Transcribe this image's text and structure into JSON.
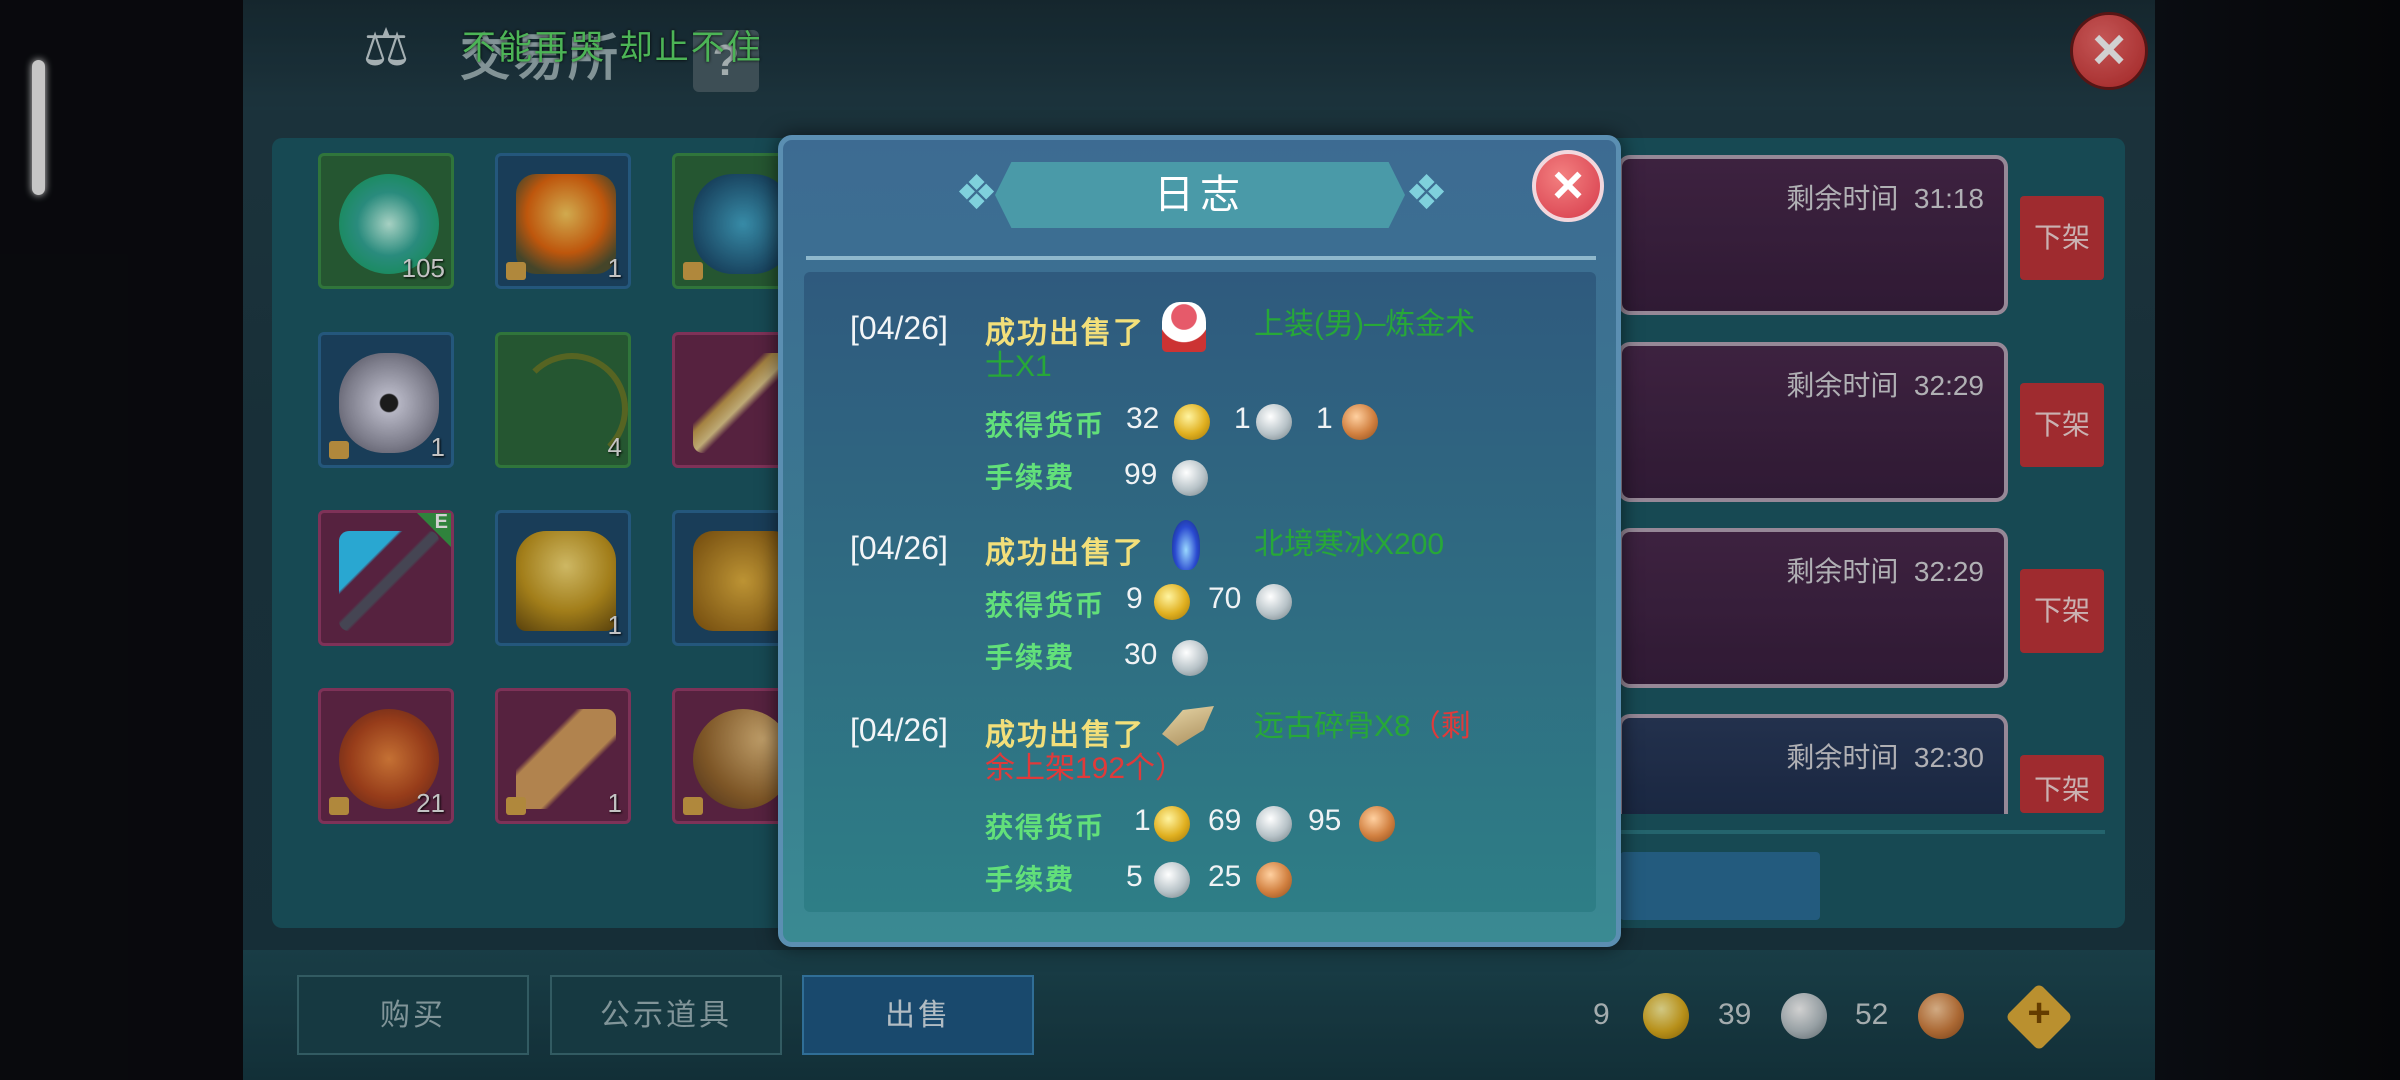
{
  "background": {
    "title": "交易所",
    "help_label": "?",
    "scroll_text": "不能再哭 却止不住",
    "close_symbol": "×",
    "grid": [
      {
        "count": "105",
        "style": "green",
        "icon": "orb-icon"
      },
      {
        "count": "1",
        "style": "blue",
        "icon": "campfire-icon"
      },
      {
        "count": "",
        "style": "green",
        "icon": "beetle-icon"
      },
      {
        "count": "1",
        "style": "blue",
        "icon": "stone-icon"
      },
      {
        "count": "4",
        "style": "green",
        "icon": "bow-icon"
      },
      {
        "count": "",
        "style": "pink",
        "icon": "dagger-icon"
      },
      {
        "count": "",
        "style": "pink",
        "icon": "staff-icon",
        "badge": "E"
      },
      {
        "count": "1",
        "style": "blue",
        "icon": "helmet-icon"
      },
      {
        "count": "",
        "style": "blue",
        "icon": "armor-icon"
      },
      {
        "count": "21",
        "style": "pink",
        "icon": "bread-icon"
      },
      {
        "count": "1",
        "style": "pink",
        "icon": "club-icon"
      },
      {
        "count": "",
        "style": "pink",
        "icon": "fan-icon"
      }
    ],
    "listings": [
      {
        "time_label": "剩余时间",
        "time": "31:18",
        "delist": "下架"
      },
      {
        "time_label": "剩余时间",
        "time": "32:29",
        "delist": "下架"
      },
      {
        "time_label": "剩余时间",
        "time": "32:29",
        "delist": "下架"
      },
      {
        "time_label": "剩余时间",
        "time": "32:30",
        "delist": "下架"
      }
    ],
    "tabs": {
      "buy": "购买",
      "announce": "公示道具",
      "sell": "出售"
    },
    "currency": {
      "gold": "9",
      "silver": "39",
      "copper": "52"
    },
    "colors": {
      "panel": "#1d5a66",
      "delist": "#c2353a",
      "tab_active": "#1f5a86"
    }
  },
  "log": {
    "title": "日志",
    "close_symbol": "×",
    "entries": [
      {
        "date": "[04/26]",
        "action": "成功出售了",
        "item_line1": "上装(男)─炼金术",
        "item_line2": "士X1",
        "income_label": "获得货币",
        "income": {
          "gold": "32",
          "silver": "1",
          "copper": "1"
        },
        "fee_label": "手续费",
        "fee": {
          "silver": "99"
        }
      },
      {
        "date": "[04/26]",
        "action": "成功出售了",
        "item_line1": "北境寒冰X200",
        "income_label": "获得货币",
        "income": {
          "gold": "9",
          "silver": "70"
        },
        "fee_label": "手续费",
        "fee": {
          "silver": "30"
        }
      },
      {
        "date": "[04/26]",
        "action": "成功出售了",
        "item_line1": "远古碎骨X8",
        "remain_part1": "（剩",
        "remain_part2": "余上架192个）",
        "income_label": "获得货币",
        "income": {
          "gold": "1",
          "silver": "69",
          "copper": "95"
        },
        "fee_label": "手续费",
        "fee": {
          "silver": "5",
          "copper": "25"
        }
      }
    ]
  }
}
